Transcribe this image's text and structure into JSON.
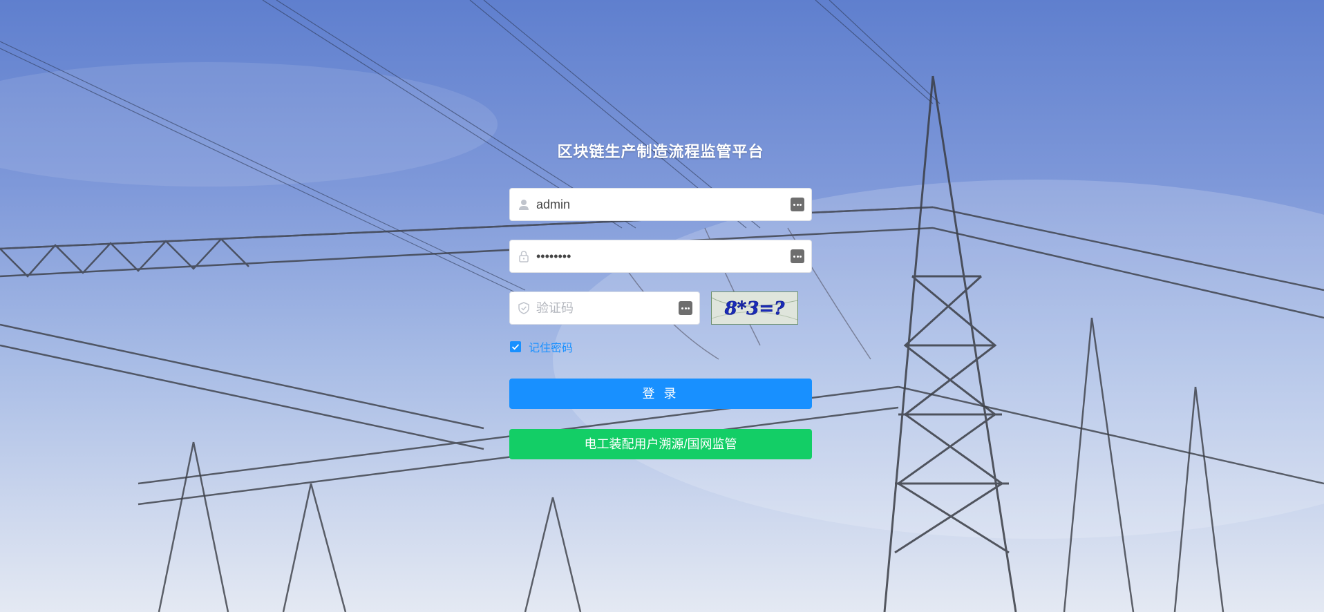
{
  "title": "区块链生产制造流程监管平台",
  "username": {
    "value": "admin",
    "icon": "user-icon"
  },
  "password": {
    "value": "12345678",
    "icon": "lock-icon"
  },
  "captcha": {
    "placeholder": "验证码",
    "icon": "shield-icon",
    "image_text": "8*3=?"
  },
  "remember": {
    "label": "记住密码",
    "checked": true
  },
  "buttons": {
    "login": "登 录",
    "trace": "电工装配用户溯源/国网监管"
  },
  "colors": {
    "primary": "#1890ff",
    "success": "#13ce66"
  }
}
